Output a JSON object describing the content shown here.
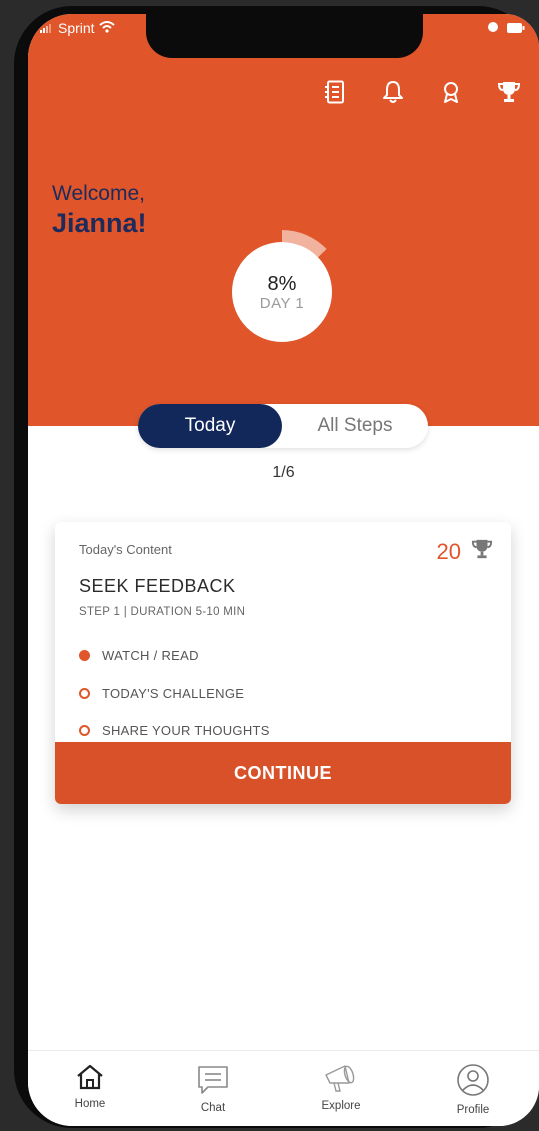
{
  "status": {
    "carrier": "Sprint"
  },
  "header": {
    "welcome": "Welcome,",
    "username": "Jianna!",
    "progress_pct": "8%",
    "progress_day": "DAY 1",
    "progress_value": 0.08
  },
  "tabs": {
    "today": "Today",
    "all_steps": "All Steps"
  },
  "step_counter": "1/6",
  "card": {
    "label": "Today's Content",
    "points": "20",
    "title": "SEEK FEEDBACK",
    "meta": "STEP 1 | DURATION 5-10 MIN",
    "tasks": [
      {
        "label": "WATCH / READ",
        "done": true
      },
      {
        "label": "TODAY'S CHALLENGE",
        "done": false
      },
      {
        "label": "SHARE YOUR THOUGHTS",
        "done": false
      }
    ],
    "continue": "CONTINUE"
  },
  "nav": {
    "home": "Home",
    "chat": "Chat",
    "explore": "Explore",
    "profile": "Profile"
  },
  "colors": {
    "accent": "#e05529",
    "navy": "#12275a",
    "navy_text": "#1d2b5c"
  }
}
